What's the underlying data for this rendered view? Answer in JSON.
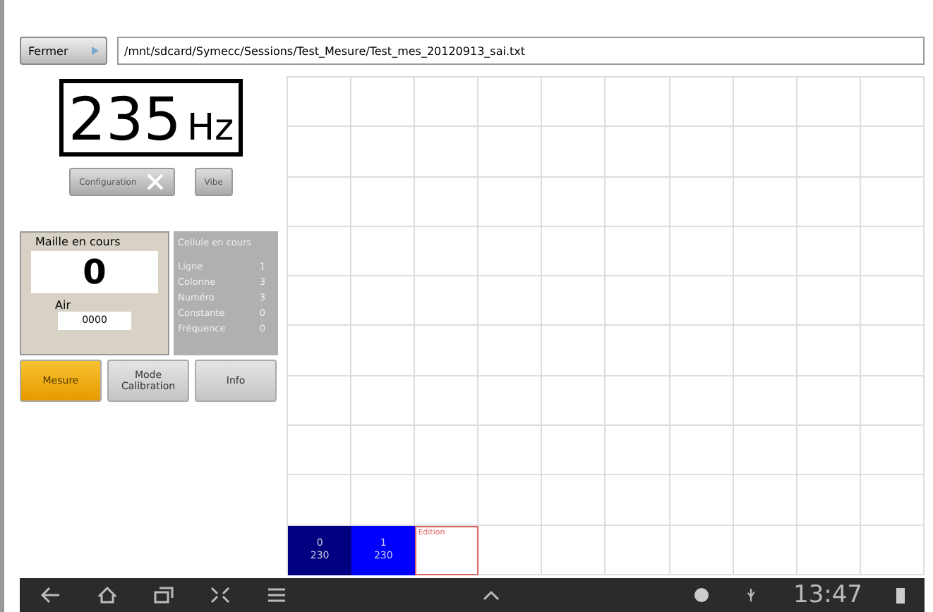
{
  "top_bar": {
    "close_button": "Fermer",
    "file_path": "/mnt/sdcard/Symecc/Sessions/Test_Mesure/Test_mes_20120913_sai.txt"
  },
  "frequency": {
    "value": "235",
    "unit": "Hz"
  },
  "tool_buttons": [
    {
      "label": "Configuration",
      "kind": "icon"
    },
    {
      "label": "Vibe",
      "kind": "plain"
    }
  ],
  "current_mesh": {
    "title": "Maille en cours",
    "value": "0",
    "air_label": "Air",
    "air_value": "0000"
  },
  "current_cell": {
    "title": "Cellule en cours",
    "rows": [
      {
        "label": "Ligne",
        "value": "1"
      },
      {
        "label": "Colonne",
        "value": "3"
      },
      {
        "label": "Numéro",
        "value": "3"
      },
      {
        "label": "Constante",
        "value": "0"
      },
      {
        "label": "Fréquence",
        "value": "0"
      }
    ]
  },
  "mode_buttons": [
    {
      "label": "Mesure",
      "selected": true
    },
    {
      "label": "Mode Calibration",
      "selected": false
    },
    {
      "label": "Info",
      "selected": false
    }
  ],
  "grid": {
    "marked_cells": [
      {
        "kind": "measured",
        "color": "#000080",
        "number": "0",
        "value": "230"
      },
      {
        "kind": "measured",
        "color": "#0000ff",
        "number": "1",
        "value": "230"
      },
      {
        "kind": "editing",
        "label": "Edition"
      }
    ]
  },
  "status_bar": {
    "time": "13:47"
  }
}
